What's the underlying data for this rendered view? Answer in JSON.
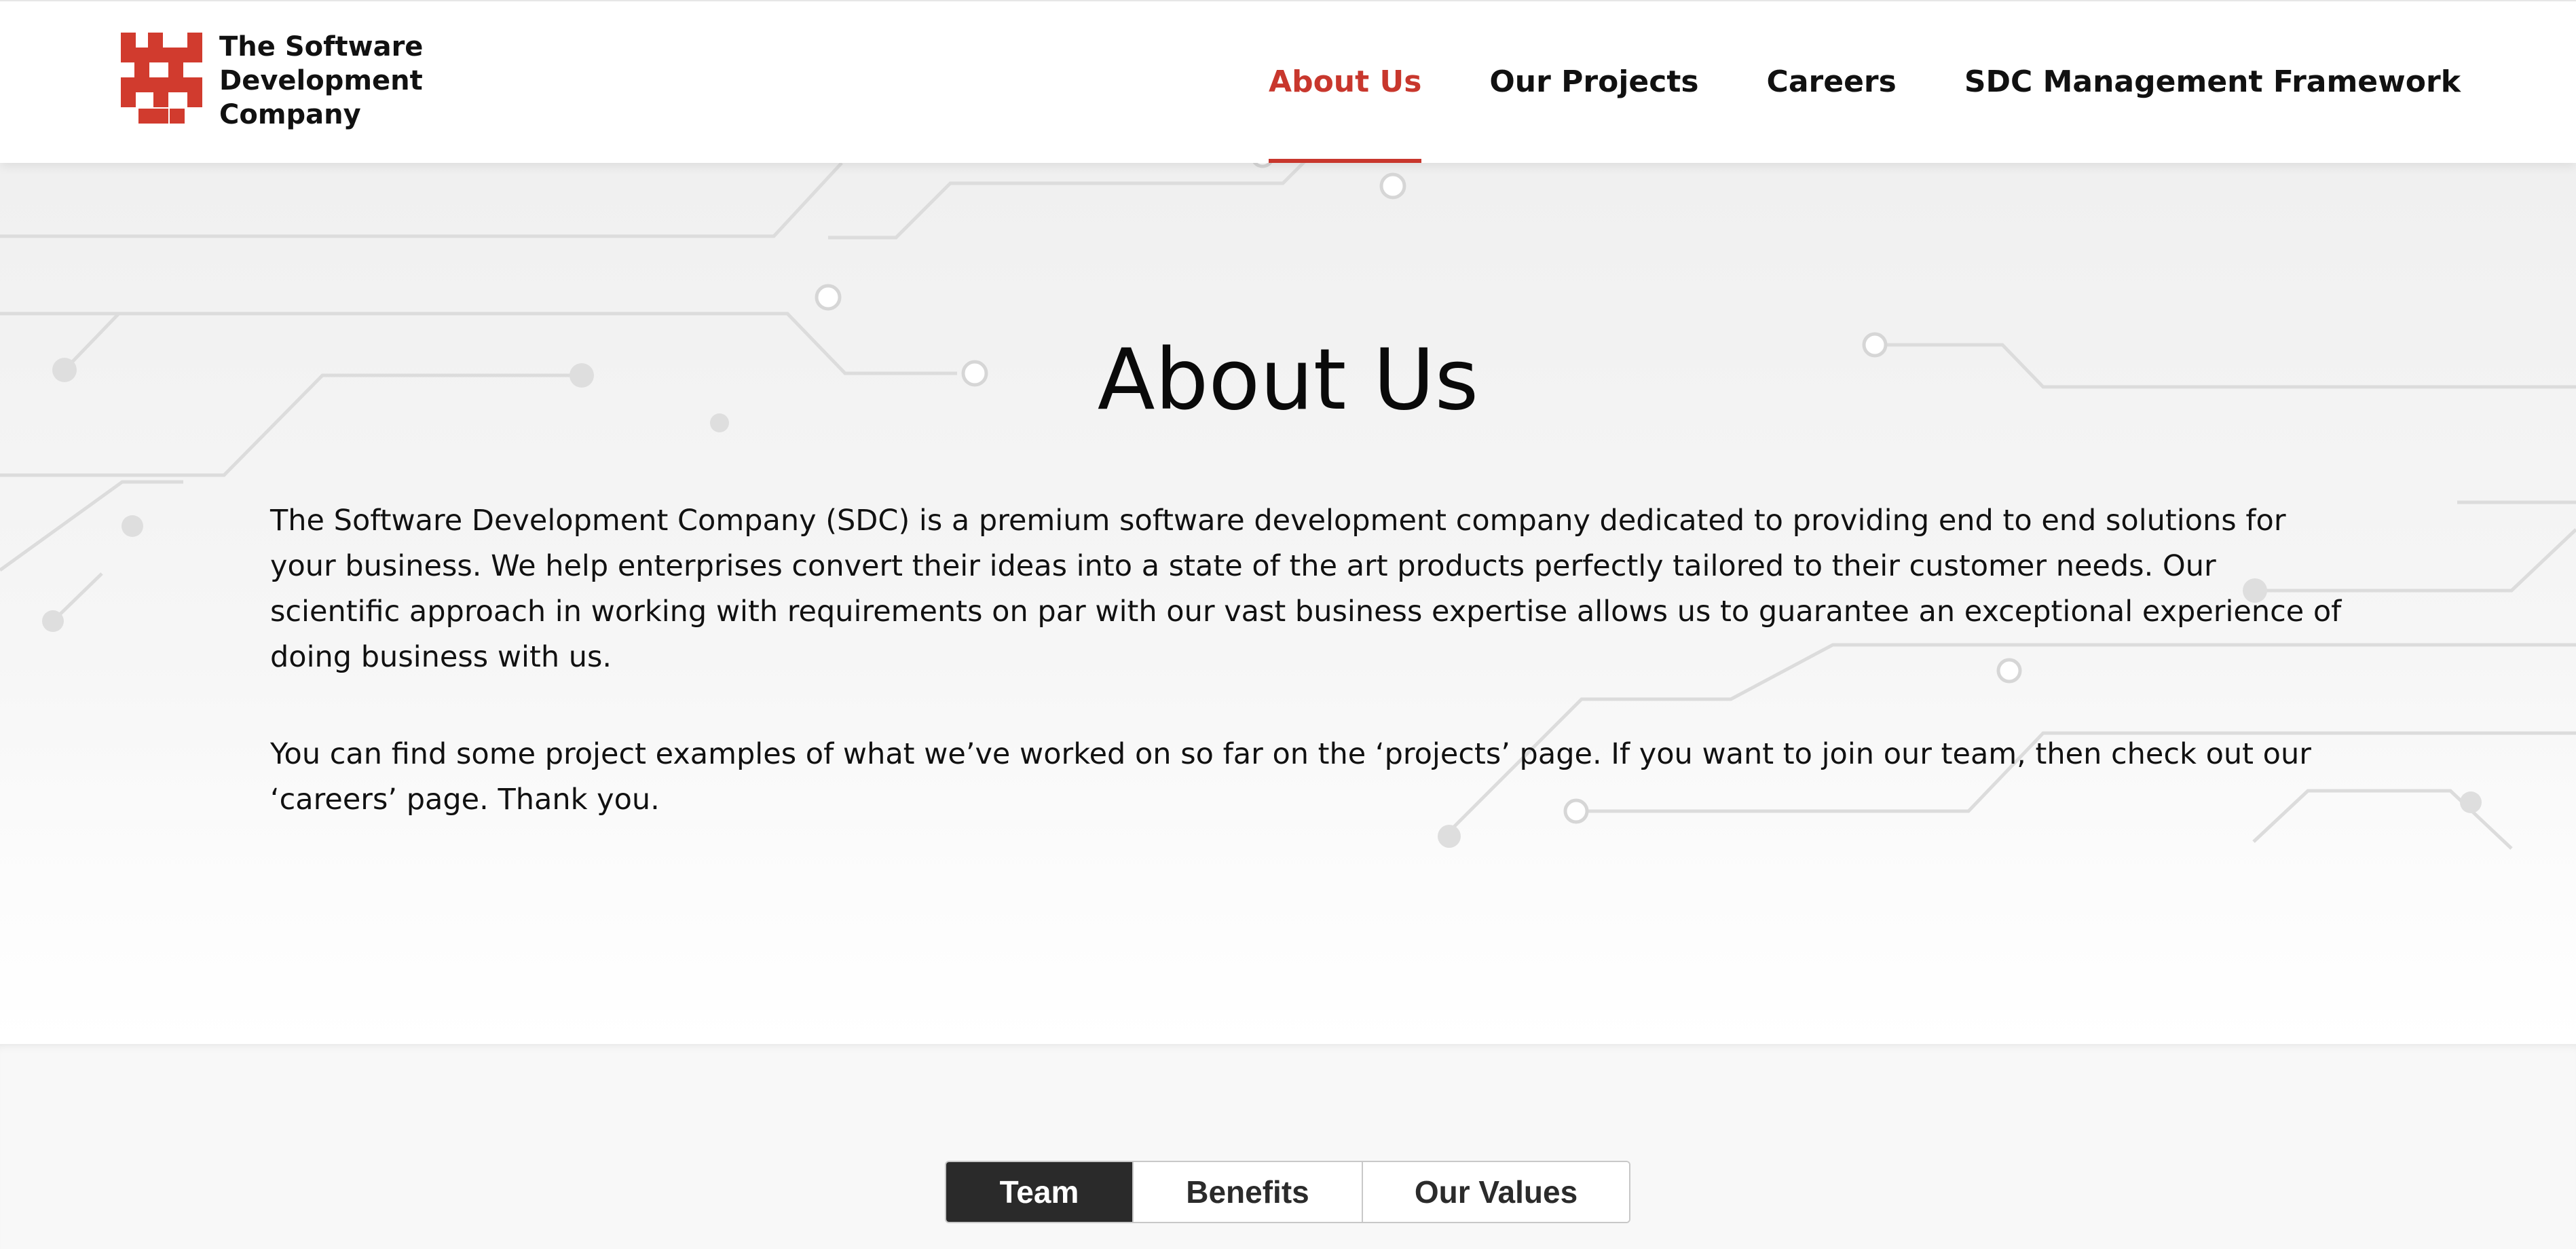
{
  "brand": {
    "name_lines": [
      "The Software",
      "Development",
      "Company"
    ],
    "accent_color": "#c8372d"
  },
  "nav": {
    "items": [
      {
        "label": "About Us",
        "active": true
      },
      {
        "label": "Our Projects",
        "active": false
      },
      {
        "label": "Careers",
        "active": false
      },
      {
        "label": "SDC Management Framework",
        "active": false
      }
    ]
  },
  "hero": {
    "title": "About Us",
    "paragraphs": [
      "The Software Development Company (SDC) is a premium software development company dedicated to providing end to end solutions for your business. We help enterprises convert their ideas into a state of the art products perfectly tailored to their customer needs. Our scientific approach in working with requirements on par with our vast business expertise allows us to guarantee an exceptional experience of doing business with us.",
      "You can find some project examples of what we’ve worked on so far on the ‘projects’ page. If you want to join our team, then check out our ‘careers’ page. Thank you."
    ]
  },
  "tabs": {
    "items": [
      {
        "label": "Team",
        "active": true
      },
      {
        "label": "Benefits",
        "active": false
      },
      {
        "label": "Our Values",
        "active": false
      }
    ]
  }
}
